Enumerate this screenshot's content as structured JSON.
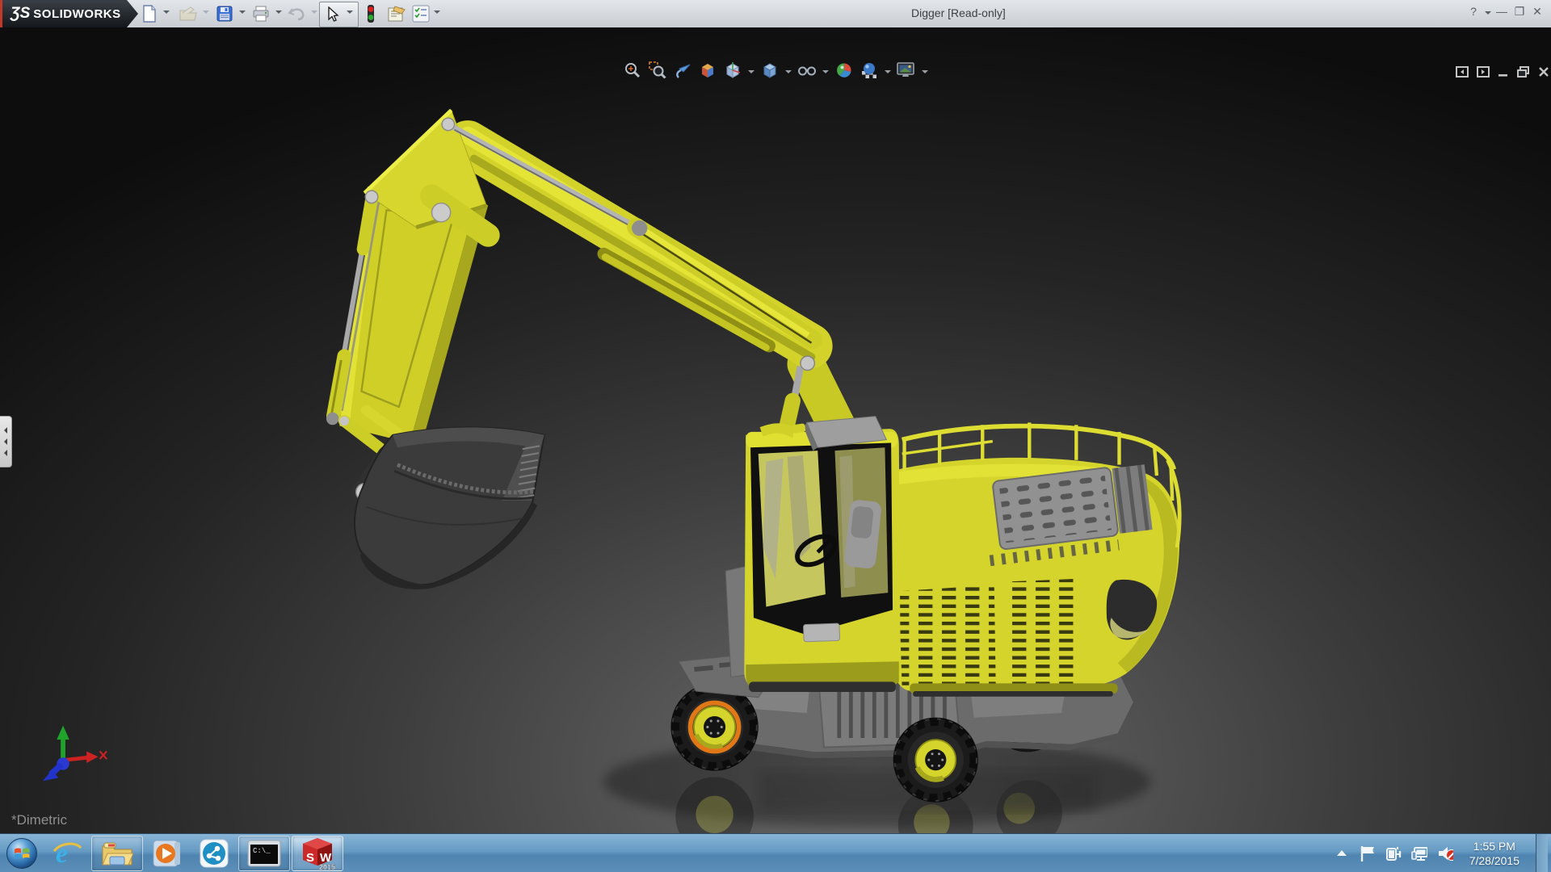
{
  "colors": {
    "machine_yellow": "#d6d62e",
    "selection_orange": "#e07818",
    "taskbar_blue": "#6399c1",
    "titlebar_gray": "#d3d7dc",
    "viewport_dark": "#0d0d0d"
  },
  "titlebar": {
    "logo_mark": "ƷS",
    "logo_text": "SOLIDWORKS",
    "title": "Digger [Read-only]",
    "help_glyph": "?",
    "minimize_glyph": "—",
    "restore_glyph": "❐",
    "close_glyph": "✕"
  },
  "main_toolbar": {
    "items": [
      {
        "name": "new-document",
        "enabled": true,
        "dropdown": true
      },
      {
        "name": "open-document",
        "enabled": false,
        "dropdown": true
      },
      {
        "name": "save",
        "enabled": true,
        "dropdown": true
      },
      {
        "name": "print",
        "enabled": true,
        "dropdown": true
      },
      {
        "name": "undo",
        "enabled": false,
        "dropdown": true
      },
      {
        "name": "select-tool",
        "enabled": true,
        "pressed": true,
        "dropdown": true
      },
      {
        "name": "display-states-traffic-light",
        "enabled": true,
        "dropdown": false
      },
      {
        "name": "comment-note",
        "enabled": true,
        "dropdown": false
      },
      {
        "name": "design-checklist",
        "enabled": true,
        "dropdown": true
      }
    ]
  },
  "heads_up_toolbar": {
    "items": [
      {
        "name": "zoom-to-fit",
        "dropdown": false
      },
      {
        "name": "zoom-to-area",
        "dropdown": false
      },
      {
        "name": "previous-view",
        "dropdown": false
      },
      {
        "name": "section-view",
        "dropdown": false
      },
      {
        "name": "view-orientation",
        "dropdown": true
      },
      {
        "name": "display-style",
        "dropdown": true
      },
      {
        "name": "hide-show-items",
        "dropdown": true
      },
      {
        "name": "edit-appearance",
        "dropdown": false
      },
      {
        "name": "apply-scene",
        "dropdown": true
      },
      {
        "name": "view-settings",
        "dropdown": true
      }
    ]
  },
  "viewport": {
    "view_name": "*Dimetric",
    "model_name": "Digger excavator 3D model",
    "triad_x_label": "x",
    "selection": "front wheel rim highlighted orange"
  },
  "taskbar": {
    "apps": [
      {
        "name": "start-button"
      },
      {
        "name": "internet-explorer",
        "running": false
      },
      {
        "name": "windows-explorer",
        "running": true
      },
      {
        "name": "media-player",
        "running": false
      },
      {
        "name": "share-app",
        "running": false
      },
      {
        "name": "command-prompt",
        "running": true
      },
      {
        "name": "solidworks-2015",
        "running": true,
        "active": true
      }
    ],
    "cmd_glyph": "C:\\_",
    "sw_badge": {
      "s": "S",
      "w": "W",
      "year": "2015"
    },
    "tray_icons": [
      "show-hidden-icons",
      "action-center-flag",
      "power-plug",
      "network-display",
      "volume-muted"
    ],
    "clock": {
      "time": "1:55 PM",
      "date": "7/28/2015"
    }
  }
}
